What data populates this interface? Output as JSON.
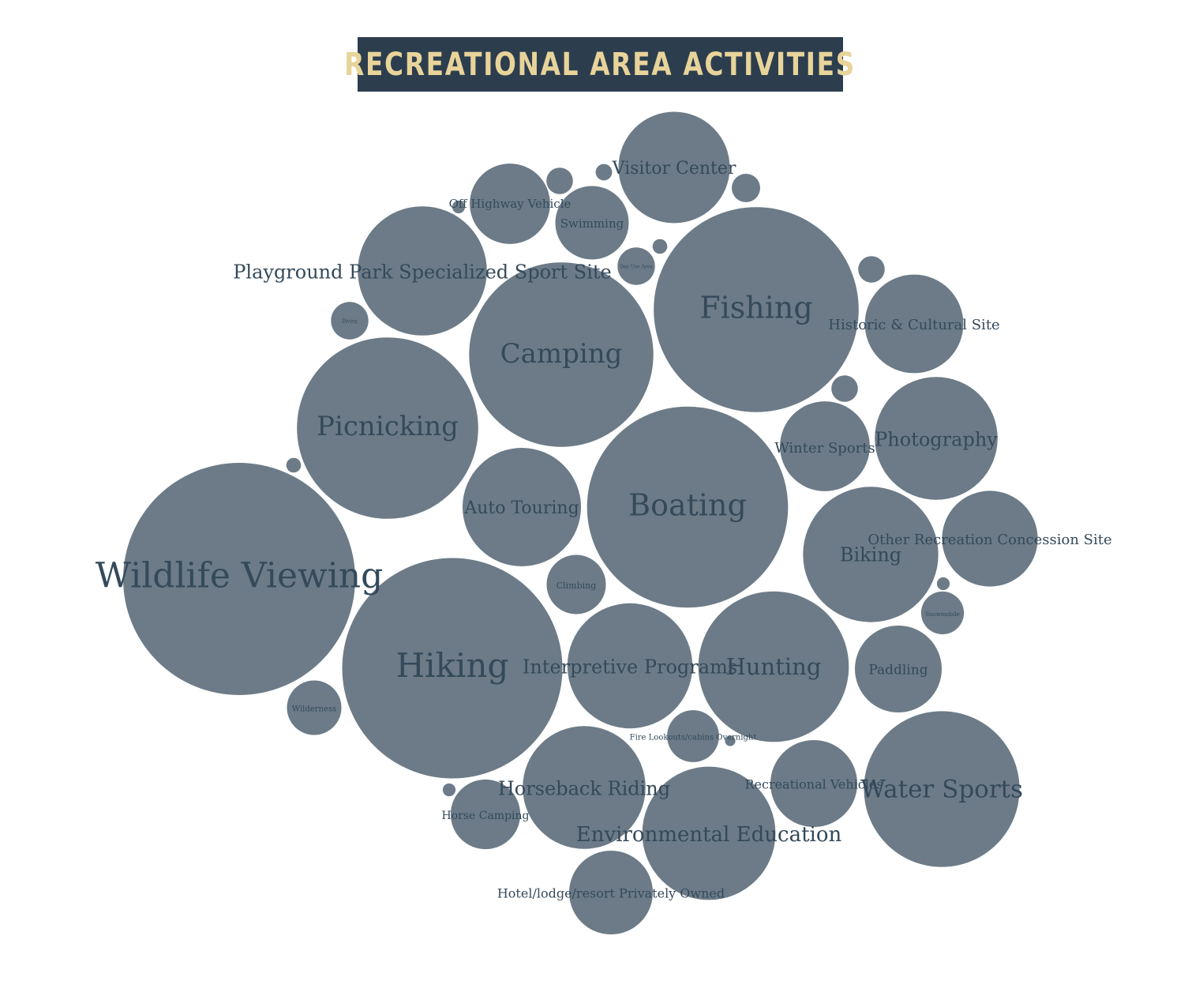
{
  "title": "RECREATIONAL AREA ACTIVITIES",
  "colors": {
    "bubble": "#6c7b87",
    "label": "#34495a",
    "title_bg": "#2c3e4e",
    "title_text": "#e8d49a"
  },
  "chart_data": {
    "type": "bubble",
    "title": "RECREATIONAL AREA ACTIVITIES",
    "bubbles": [
      {
        "label": "Wildlife Viewing",
        "value": 100
      },
      {
        "label": "Hiking",
        "value": 90
      },
      {
        "label": "Boating",
        "value": 75
      },
      {
        "label": "Fishing",
        "value": 78
      },
      {
        "label": "Camping",
        "value": 63
      },
      {
        "label": "Picnicking",
        "value": 61
      },
      {
        "label": "Water Sports",
        "value": 45
      },
      {
        "label": "Hunting",
        "value": 42
      },
      {
        "label": "Environmental Education",
        "value": 33
      },
      {
        "label": "Horseback Riding",
        "value": 28
      },
      {
        "label": "Biking",
        "value": 34
      },
      {
        "label": "Interpretive Programs",
        "value": 29
      },
      {
        "label": "Playground Park Specialized Sport Site",
        "value": 31
      },
      {
        "label": "Photography",
        "value": 28
      },
      {
        "label": "Visitor Center",
        "value": 23
      },
      {
        "label": "Auto Touring",
        "value": 26
      },
      {
        "label": "Other Recreation Concession Site",
        "value": 17
      },
      {
        "label": "Historic & Cultural Site",
        "value": 18
      },
      {
        "label": "Winter Sports",
        "value": 15
      },
      {
        "label": "Paddling",
        "value": 14
      },
      {
        "label": "Recreational Vehicles",
        "value": 14
      },
      {
        "label": "Hotel/lodge/resort Privately Owned",
        "value": 13
      },
      {
        "label": "Swimming",
        "value": 10
      },
      {
        "label": "Off Highway Vehicle",
        "value": 12
      },
      {
        "label": "Horse Camping",
        "value": 9
      },
      {
        "label": "Climbing",
        "value": 6.5
      },
      {
        "label": "Wilderness",
        "value": 5.5
      },
      {
        "label": "Fire Lookouts/cabins Overnight",
        "value": 5
      },
      {
        "label": "Snowmobile",
        "value": 3.4
      },
      {
        "label": "Diving",
        "value": 2.6
      },
      {
        "label": "Day Use Area",
        "value": 2.6
      },
      {
        "label": "",
        "value": 1.5
      },
      {
        "label": "",
        "value": 1.3
      },
      {
        "label": "",
        "value": 1.3
      },
      {
        "label": "",
        "value": 1.3
      },
      {
        "label": "",
        "value": 0.5
      },
      {
        "label": "",
        "value": 0.4
      },
      {
        "label": "",
        "value": 0.4
      },
      {
        "label": "",
        "value": 0.3
      },
      {
        "label": "",
        "value": 0.3
      },
      {
        "label": "",
        "value": 0.3
      },
      {
        "label": "",
        "value": 0.2
      },
      {
        "label": "",
        "value": 0.2
      }
    ]
  }
}
